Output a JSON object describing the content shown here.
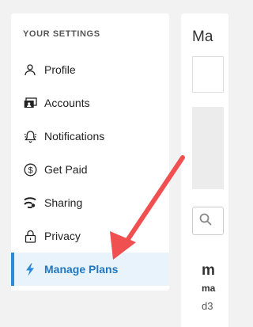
{
  "sidebar": {
    "heading": "YOUR SETTINGS",
    "items": [
      {
        "label": "Profile",
        "icon": "user-icon"
      },
      {
        "label": "Accounts",
        "icon": "accounts-icon"
      },
      {
        "label": "Notifications",
        "icon": "bell-icon"
      },
      {
        "label": "Get Paid",
        "icon": "dollar-icon"
      },
      {
        "label": "Sharing",
        "icon": "share-icon"
      },
      {
        "label": "Privacy",
        "icon": "lock-icon"
      },
      {
        "label": "Manage Plans",
        "icon": "lightning-icon",
        "active": true
      }
    ]
  },
  "main": {
    "title": "Ma",
    "card_line1": "m",
    "card_line2": "ma",
    "card_line3": "d3"
  },
  "colors": {
    "accent": "#2a8ad8",
    "active_text": "#1f78c4",
    "active_bg": "#e9f3fb",
    "annotation_arrow": "#f05050"
  }
}
